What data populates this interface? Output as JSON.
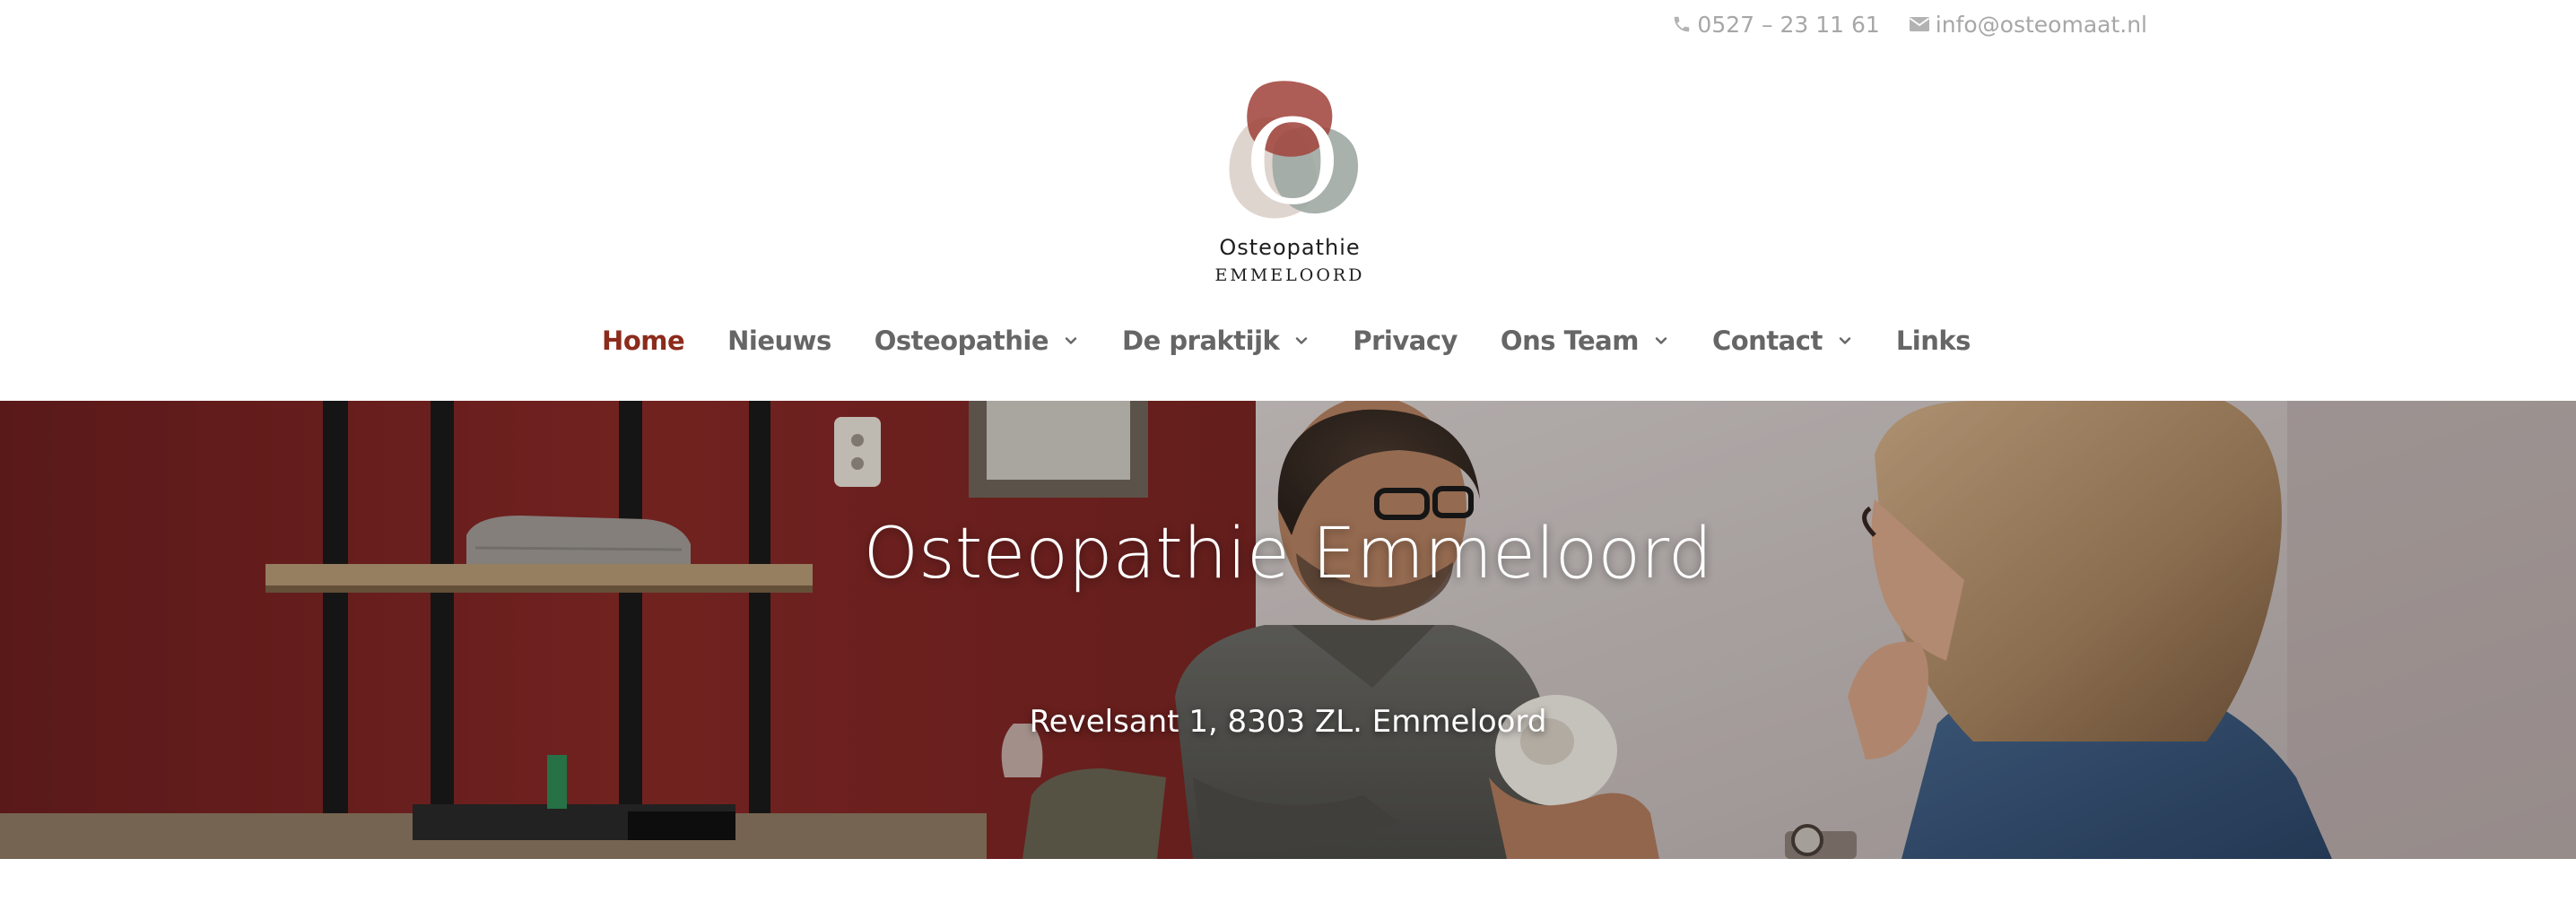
{
  "topbar": {
    "phone": "0527 – 23 11 61",
    "email": "info@osteomaat.nl",
    "phone_icon": "phone-icon",
    "email_icon": "envelope-icon"
  },
  "logo": {
    "letter": "O",
    "line1": "Osteopathie",
    "line2": "EMMELOORD"
  },
  "nav": {
    "items": [
      {
        "label": "Home",
        "active": true,
        "dropdown": false
      },
      {
        "label": "Nieuws",
        "active": false,
        "dropdown": false
      },
      {
        "label": "Osteopathie",
        "active": false,
        "dropdown": true
      },
      {
        "label": "De praktijk",
        "active": false,
        "dropdown": true
      },
      {
        "label": "Privacy",
        "active": false,
        "dropdown": false
      },
      {
        "label": "Ons Team",
        "active": false,
        "dropdown": true
      },
      {
        "label": "Contact",
        "active": false,
        "dropdown": true
      },
      {
        "label": "Links",
        "active": false,
        "dropdown": false
      }
    ]
  },
  "hero": {
    "title": "Osteopathie Emmeloord",
    "address": "Revelsant 1, 8303 ZL. Emmeloord"
  },
  "colors": {
    "accent": "#8c2b1c",
    "nav_text": "#666666",
    "topbar_text": "#a7a7a7",
    "logo_red": "#a2473f",
    "logo_gray": "#9ea8a3",
    "logo_beige": "#ddd3cc"
  }
}
